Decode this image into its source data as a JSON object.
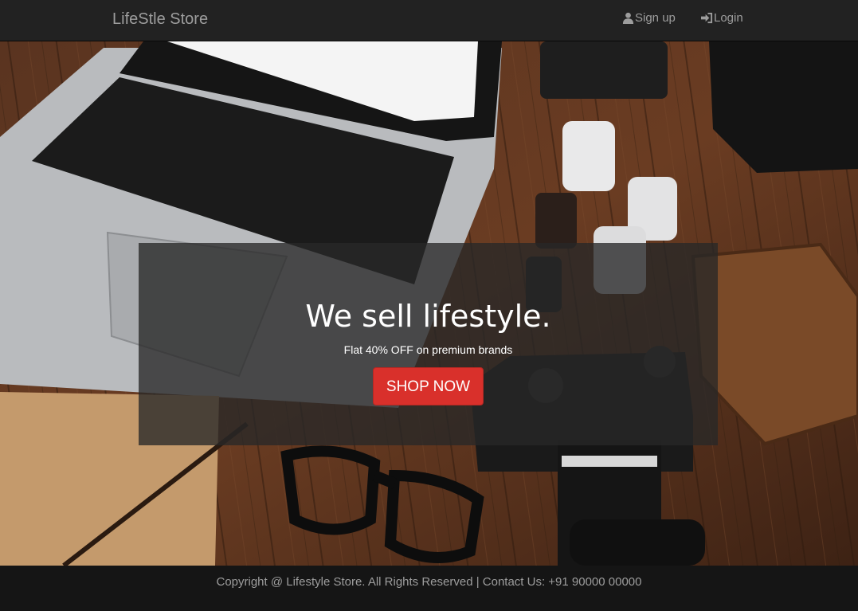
{
  "navbar": {
    "brand": "LifeStle Store",
    "signup_label": "Sign up",
    "signup_icon": "user-icon",
    "login_label": "Login",
    "login_icon": "log-in-icon"
  },
  "hero": {
    "title": "We sell lifestyle.",
    "subtitle": "Flat 40% OFF on premium brands",
    "button_label": "SHOP NOW",
    "button_color": "#d9302b"
  },
  "footer": {
    "text": "Copyright @ Lifestyle Store. All Rights Reserved | Contact Us: +91 90000 00000"
  }
}
